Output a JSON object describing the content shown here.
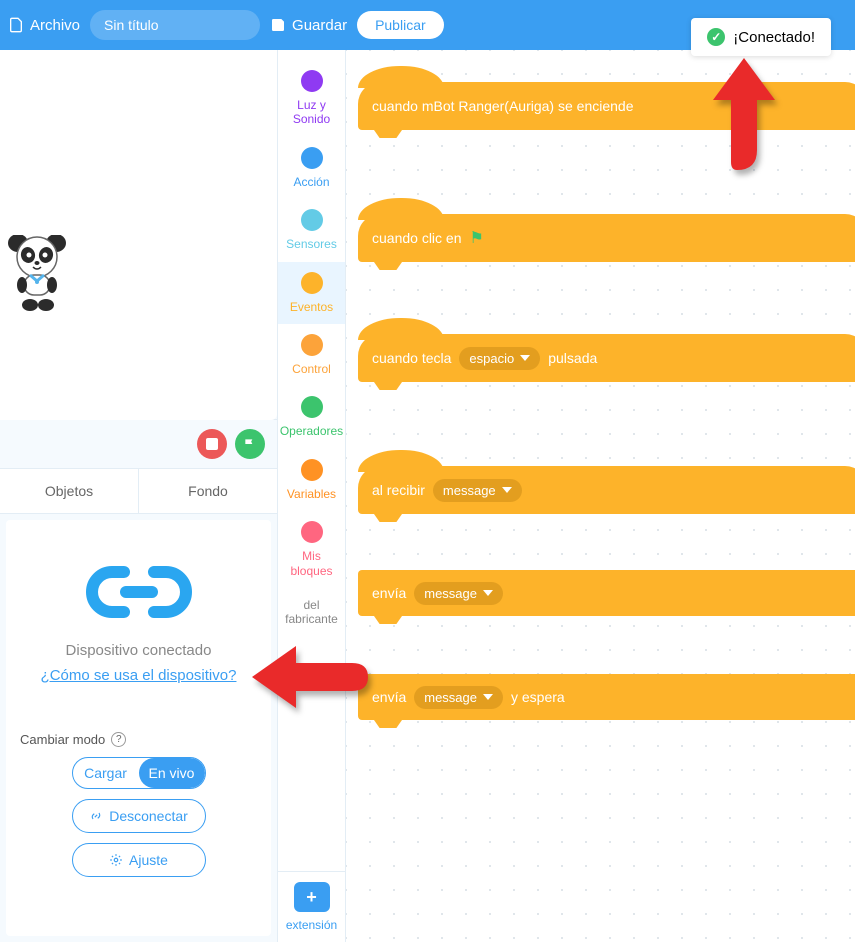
{
  "topbar": {
    "file_label": "Archivo",
    "title": "Sin título",
    "save_label": "Guardar",
    "publish_label": "Publicar"
  },
  "status": {
    "text": "¡Conectado!"
  },
  "stage_tabs": {
    "objects_label": "Objetos",
    "background_label": "Fondo"
  },
  "device_panel": {
    "status_text": "Dispositivo conectado",
    "help_text": "¿Cómo se usa el dispositivo?",
    "mode_label": "Cambiar modo",
    "toggle_load": "Cargar",
    "toggle_live": "En vivo",
    "disconnect_label": "Desconectar",
    "settings_label": "Ajuste"
  },
  "categories": [
    {
      "label": "Luz y\nSonido",
      "color": "#8f3af2",
      "text": "#8f3af2"
    },
    {
      "label": "Acción",
      "color": "#3a9ef2",
      "text": "#3a9ef2"
    },
    {
      "label": "Sensores",
      "color": "#63cbe6",
      "text": "#63cbe6"
    },
    {
      "label": "Eventos",
      "color": "#fdb32a",
      "text": "#fdb32a"
    },
    {
      "label": "Control",
      "color": "#fca33a",
      "text": "#fca33a"
    },
    {
      "label": "Operadores",
      "color": "#3cc46d",
      "text": "#3cc46d"
    },
    {
      "label": "Variables",
      "color": "#ff9224",
      "text": "#ff9224"
    },
    {
      "label": "Mis\nbloques",
      "color": "#ff6680",
      "text": "#ff6680"
    },
    {
      "label": "del\nfabricante",
      "color": "",
      "text": "#888"
    }
  ],
  "extension_label": "extensión",
  "blocks": {
    "b1": {
      "text": "cuando mBot Ranger(Auriga) se enciende"
    },
    "b2": {
      "text": "cuando clic en"
    },
    "b3": {
      "prefix": "cuando tecla",
      "arg": "espacio",
      "suffix": "pulsada"
    },
    "b4": {
      "prefix": "al recibir",
      "arg": "message"
    },
    "b5": {
      "prefix": "envía",
      "arg": "message"
    },
    "b6": {
      "prefix": "envía",
      "arg": "message",
      "suffix": "y espera"
    }
  }
}
